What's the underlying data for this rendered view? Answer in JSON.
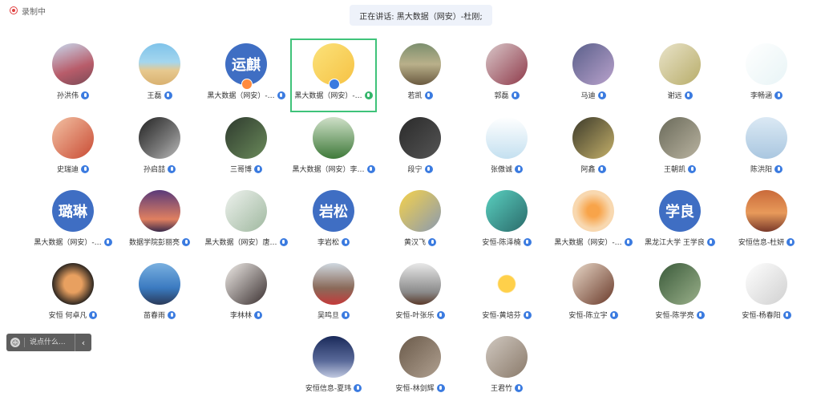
{
  "recording": {
    "label": "录制中"
  },
  "speaking": {
    "text": "正在讲话: 黑大数据（网安）-杜刚;"
  },
  "chat": {
    "placeholder": "说点什么...",
    "collapse": "‹"
  },
  "colors": {
    "accent_blue": "#3b7be0",
    "active_border": "#3fc37a",
    "host_badge": "#ff8a3d"
  },
  "participants": [
    {
      "name": "孙洪伟",
      "avatar_text": "",
      "bg": "linear-gradient(160deg,#c7d9ee,#b85c6a 60%,#7a4a56)",
      "mic": "blue"
    },
    {
      "name": "王磊",
      "avatar_text": "",
      "bg": "linear-gradient(180deg,#7fc3ea 0%,#a4d6ee 45%,#e7c98f 65%,#d9b170)",
      "mic": "blue"
    },
    {
      "name": "黑大数据（网安）-…",
      "avatar_text": "运麒",
      "bg": "#3f6ec3",
      "mic": "blue",
      "badge": "orange"
    },
    {
      "name": "黑大数据（网安）-…",
      "avatar_text": "",
      "bg": "linear-gradient(135deg,#fbe27a,#f6c244)",
      "mic": "green",
      "badge": "blue",
      "active": true
    },
    {
      "name": "若凯",
      "avatar_text": "",
      "bg": "linear-gradient(180deg,#7c8f6e,#b9b08a 50%,#6a5a40)",
      "mic": "blue"
    },
    {
      "name": "郭磊",
      "avatar_text": "",
      "bg": "linear-gradient(135deg,#d9c7c9,#8f3a4a)",
      "mic": "blue"
    },
    {
      "name": "马迪",
      "avatar_text": "",
      "bg": "linear-gradient(135deg,#5a5f8a,#b9a2cc)",
      "mic": "blue"
    },
    {
      "name": "谢远",
      "avatar_text": "",
      "bg": "linear-gradient(135deg,#e9e3c9,#b8ad6a)",
      "mic": "blue"
    },
    {
      "name": "李畅涵",
      "avatar_text": "",
      "bg": "linear-gradient(135deg,#ffffff,#e8f4f6)",
      "mic": "blue"
    },
    {
      "name": "史瑞迪",
      "avatar_text": "",
      "bg": "linear-gradient(135deg,#f3c2a4,#c94b34)",
      "mic": "blue"
    },
    {
      "name": "孙启喆",
      "avatar_text": "",
      "bg": "linear-gradient(135deg,#222,#777 60%,#bbb)",
      "mic": "blue"
    },
    {
      "name": "三哥博",
      "avatar_text": "",
      "bg": "linear-gradient(135deg,#2e3a2e,#6a8a5a)",
      "mic": "blue"
    },
    {
      "name": "黑大数据（网安）李…",
      "avatar_text": "",
      "bg": "linear-gradient(180deg,#cfe0c8,#3f7a3a)",
      "mic": "blue"
    },
    {
      "name": "段宁",
      "avatar_text": "",
      "bg": "linear-gradient(135deg,#2a2a2a,#555)",
      "mic": "blue"
    },
    {
      "name": "张傲诚",
      "avatar_text": "",
      "bg": "linear-gradient(180deg,#ffffff,#c4e0f0)",
      "mic": "blue"
    },
    {
      "name": "阿鑫",
      "avatar_text": "",
      "bg": "linear-gradient(135deg,#3c3a2a,#c4b06a)",
      "mic": "blue"
    },
    {
      "name": "王朝凯",
      "avatar_text": "",
      "bg": "linear-gradient(135deg,#6a6a5a,#b9b3a0)",
      "mic": "blue"
    },
    {
      "name": "陈洪阳",
      "avatar_text": "",
      "bg": "linear-gradient(180deg,#dbe9f4,#aac7e0)",
      "mic": "blue"
    },
    {
      "name": "黑大数据（网安）-…",
      "avatar_text": "璐琳",
      "bg": "#3f6ec3",
      "mic": "blue"
    },
    {
      "name": "数据学院彭丽亮",
      "avatar_text": "",
      "bg": "linear-gradient(180deg,#5a3a7a,#e08060 70%,#3a2a4a)",
      "mic": "blue"
    },
    {
      "name": "黑大数据（网安）唐…",
      "avatar_text": "",
      "bg": "linear-gradient(135deg,#eef2ee,#9fb89f)",
      "mic": "blue"
    },
    {
      "name": "李岩松",
      "avatar_text": "岩松",
      "bg": "#3f6ec3",
      "mic": "blue"
    },
    {
      "name": "黄汉飞",
      "avatar_text": "",
      "bg": "linear-gradient(135deg,#f6d24a,#8a9ab0)",
      "mic": "blue"
    },
    {
      "name": "安恒-陈泽楠",
      "avatar_text": "",
      "bg": "linear-gradient(135deg,#5ad0c0,#2a6a6a)",
      "mic": "blue"
    },
    {
      "name": "黑大数据（网安）-…",
      "avatar_text": "",
      "bg": "radial-gradient(circle,#f8a44a 20%,#f8d8b0 60%)",
      "mic": "blue"
    },
    {
      "name": "黑龙江大学 王学良",
      "avatar_text": "学良",
      "bg": "#3f6ec3",
      "mic": "blue"
    },
    {
      "name": "安恒信息-杜妍",
      "avatar_text": "",
      "bg": "linear-gradient(180deg,#c96a3a,#e89a5a 55%,#7a3a2a)",
      "mic": "blue"
    },
    {
      "name": "安恒 何卓凡",
      "avatar_text": "",
      "bg": "radial-gradient(circle,#e8a060 30%,#1a1a1a 75%)",
      "mic": "blue"
    },
    {
      "name": "苗春雨",
      "avatar_text": "",
      "bg": "linear-gradient(180deg,#7ab0e0,#3a7ac0 60%,#2a3a5a)",
      "mic": "blue"
    },
    {
      "name": "李林林",
      "avatar_text": "",
      "bg": "linear-gradient(135deg,#f0ece8,#3a3030)",
      "mic": "blue"
    },
    {
      "name": "吴鸣旦",
      "avatar_text": "",
      "bg": "linear-gradient(180deg,#cfd8e0,#8a6a5a 60%,#c43a3a)",
      "mic": "blue"
    },
    {
      "name": "安恒-叶张乐",
      "avatar_text": "",
      "bg": "linear-gradient(180deg,#e8e8e8,#8a8a8a 70%,#5a3a2a)",
      "mic": "blue"
    },
    {
      "name": "安恒-黄培芬",
      "avatar_text": "",
      "bg": "radial-gradient(circle,#ffd04a 28%,#ffffff 32%)",
      "mic": "blue"
    },
    {
      "name": "安恒-陈立宇",
      "avatar_text": "",
      "bg": "linear-gradient(135deg,#e8d8c8,#6a3a2a)",
      "mic": "blue"
    },
    {
      "name": "安恒-陈学亮",
      "avatar_text": "",
      "bg": "linear-gradient(135deg,#3a5a3a,#9ab08a)",
      "mic": "blue"
    },
    {
      "name": "安恒-杨春阳",
      "avatar_text": "",
      "bg": "linear-gradient(135deg,#ffffff,#d0d0d0)",
      "mic": "blue"
    },
    {
      "name": "安恒信息-夏玮",
      "avatar_text": "",
      "bg": "linear-gradient(180deg,#1a2a5a,#5a6a9a 60%,#c0c8e0)",
      "mic": "blue"
    },
    {
      "name": "安恒-林剑辉",
      "avatar_text": "",
      "bg": "linear-gradient(135deg,#6a5a4a,#b0a090)",
      "mic": "blue"
    },
    {
      "name": "王君竹",
      "avatar_text": "",
      "bg": "linear-gradient(135deg,#d0c8c0,#8a7a6a)",
      "mic": "blue"
    }
  ]
}
